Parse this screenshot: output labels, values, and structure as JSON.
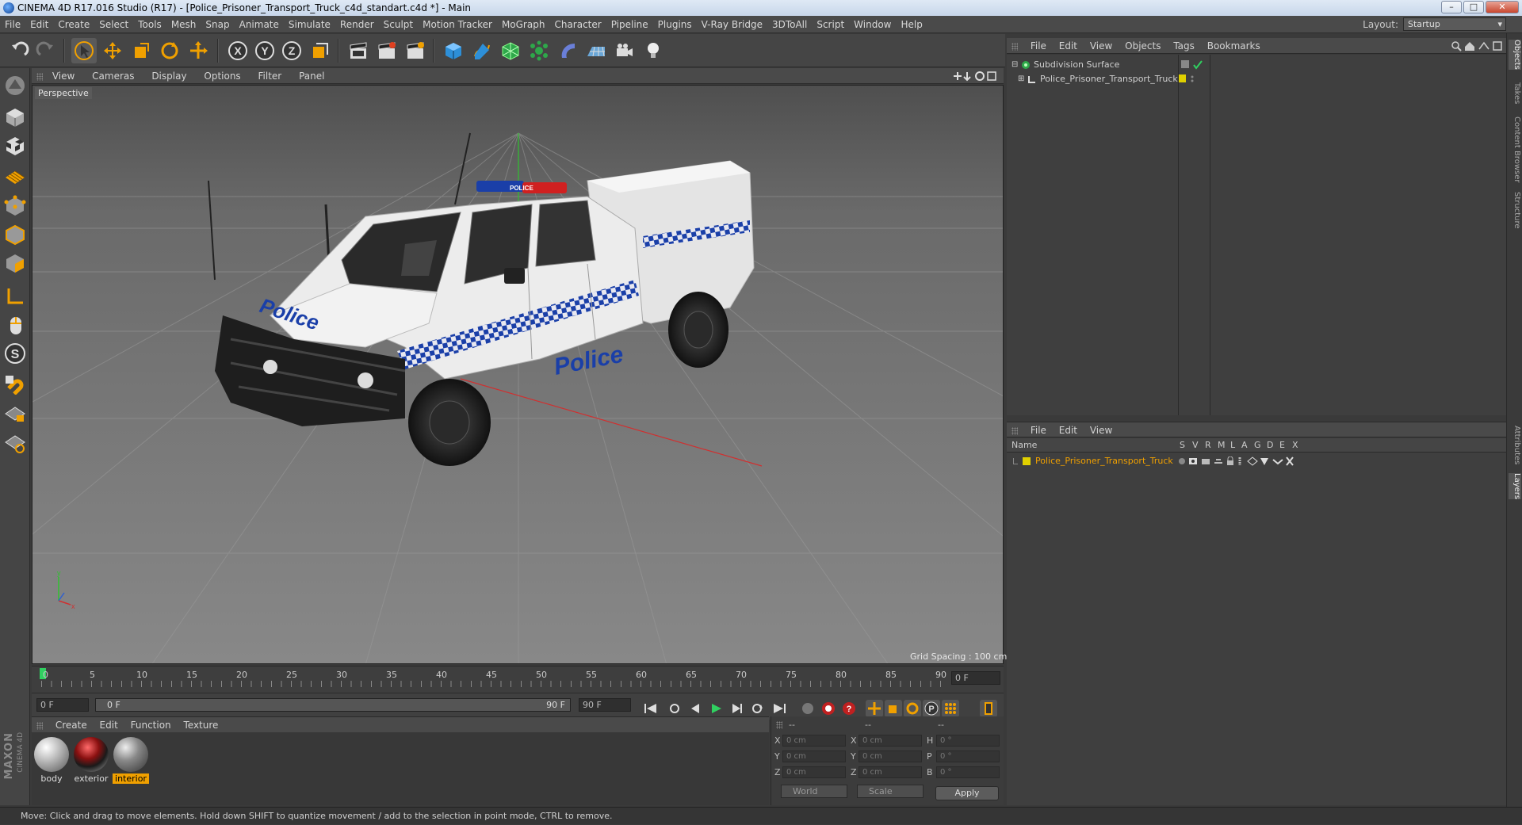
{
  "window": {
    "title": "CINEMA 4D R17.016 Studio (R17) - [Police_Prisoner_Transport_Truck_c4d_standart.c4d *] - Main",
    "minimize": "–",
    "maximize": "□",
    "close": "✕"
  },
  "menubar": {
    "items": [
      "File",
      "Edit",
      "Create",
      "Select",
      "Tools",
      "Mesh",
      "Snap",
      "Animate",
      "Simulate",
      "Render",
      "Sculpt",
      "Motion Tracker",
      "MoGraph",
      "Character",
      "Pipeline",
      "Plugins",
      "V-Ray Bridge",
      "3DToAll",
      "Script",
      "Window",
      "Help"
    ],
    "layout_label": "Layout:",
    "layout_value": "Startup"
  },
  "viewport": {
    "menu": [
      "View",
      "Cameras",
      "Display",
      "Options",
      "Filter",
      "Panel"
    ],
    "camera_label": "Perspective",
    "grid_spacing": "Grid Spacing : 100 cm",
    "decal_text": "Police",
    "lightbar_text": "POLICE"
  },
  "timeline": {
    "ticks": [
      "0",
      "5",
      "10",
      "15",
      "20",
      "25",
      "30",
      "35",
      "40",
      "45",
      "50",
      "55",
      "60",
      "65",
      "70",
      "75",
      "80",
      "85",
      "90"
    ],
    "current_frame": "0 F",
    "start_field": "0 F",
    "range_start": "0 F",
    "range_end": "90 F",
    "end_field": "90 F"
  },
  "materials": {
    "menu": [
      "Create",
      "Edit",
      "Function",
      "Texture"
    ],
    "items": [
      {
        "name": "body",
        "selected": false
      },
      {
        "name": "exterior",
        "selected": false
      },
      {
        "name": "interior",
        "selected": true
      }
    ]
  },
  "coordinates": {
    "header": [
      "--",
      "--",
      "--"
    ],
    "rows": [
      {
        "a": "X",
        "av": "0 cm",
        "b": "X",
        "bv": "0 cm",
        "c": "H",
        "cv": "0 °"
      },
      {
        "a": "Y",
        "av": "0 cm",
        "b": "Y",
        "bv": "0 cm",
        "c": "P",
        "cv": "0 °"
      },
      {
        "a": "Z",
        "av": "0 cm",
        "b": "Z",
        "bv": "0 cm",
        "c": "B",
        "cv": "0 °"
      }
    ],
    "mode": "World",
    "scale": "Scale",
    "apply": "Apply"
  },
  "objects": {
    "menu": [
      "File",
      "Edit",
      "View",
      "Objects",
      "Tags",
      "Bookmarks"
    ],
    "items": [
      {
        "name": "Subdivision Surface"
      },
      {
        "name": "Police_Prisoner_Transport_Truck"
      }
    ]
  },
  "layers": {
    "menu": [
      "File",
      "Edit",
      "View"
    ],
    "columns": [
      "Name",
      "S",
      "V",
      "R",
      "M",
      "L",
      "A",
      "G",
      "D",
      "E",
      "X"
    ],
    "items": [
      {
        "name": "Police_Prisoner_Transport_Truck"
      }
    ]
  },
  "right_tabs": [
    "Objects",
    "Takes",
    "Content Browser",
    "Structure",
    "Attributes",
    "Layers"
  ],
  "logo": {
    "line1": "MAXON",
    "line2": "CINEMA 4D"
  },
  "status": "Move: Click and drag to move elements. Hold down SHIFT to quantize movement / add to the selection in point mode, CTRL to remove.",
  "colors": {
    "accent": "#f0a000",
    "axis_x": "#d03030",
    "axis_y": "#30c030",
    "layer_yellow": "#e0d000",
    "police_blue": "#1a3fa8"
  }
}
